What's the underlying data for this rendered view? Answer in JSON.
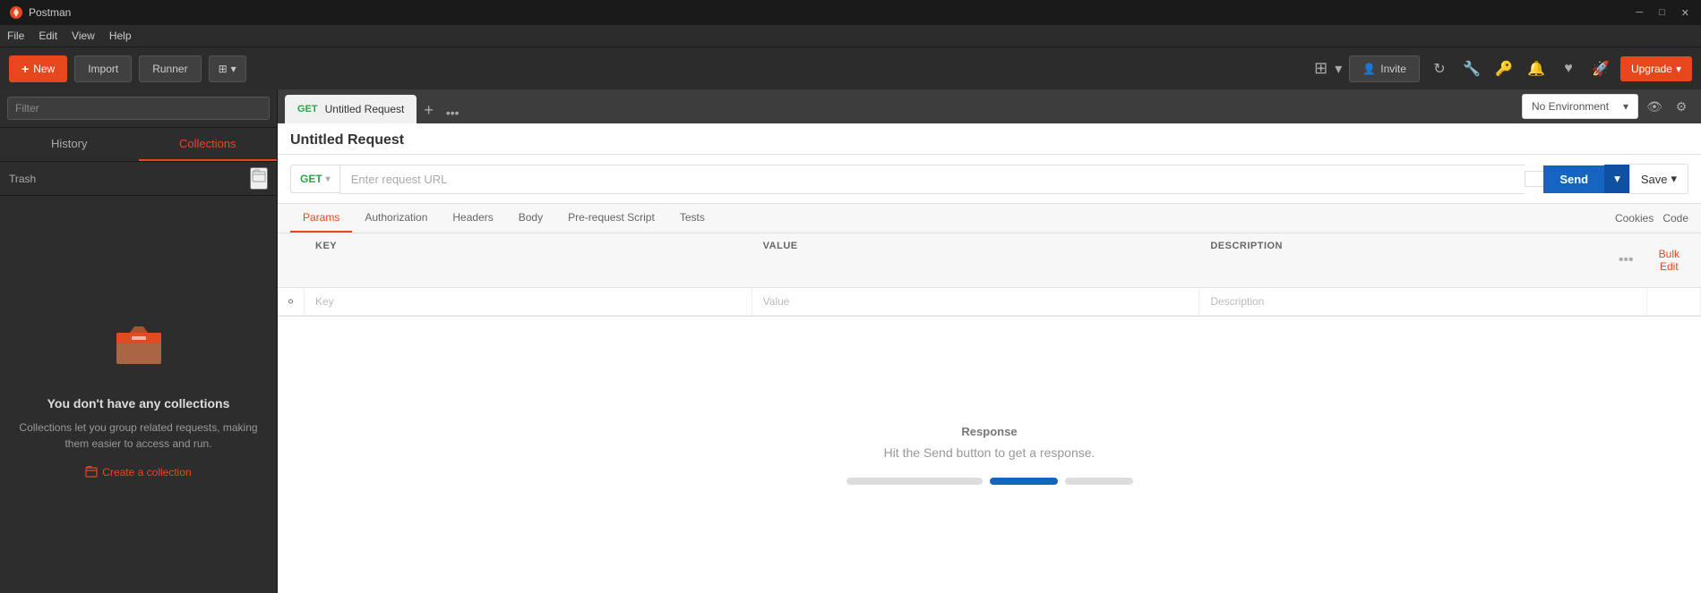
{
  "app": {
    "title": "Postman",
    "window_controls": {
      "minimize": "─",
      "maximize": "□",
      "close": "✕"
    }
  },
  "menu": {
    "items": [
      "File",
      "Edit",
      "View",
      "Help"
    ]
  },
  "toolbar": {
    "new_label": "New",
    "import_label": "Import",
    "runner_label": "Runner",
    "custom_icon": "⊞",
    "grid_icon": "⊞",
    "invite_label": "Invite",
    "sync_icon": "↻",
    "wrench_icon": "🔧",
    "bell_icon": "🔔",
    "heart_icon": "♥",
    "rocket_icon": "🚀",
    "upgrade_label": "Upgrade",
    "upgrade_dropdown": "▾"
  },
  "sidebar": {
    "search_placeholder": "Filter",
    "tabs": [
      {
        "id": "history",
        "label": "History"
      },
      {
        "id": "collections",
        "label": "Collections"
      }
    ],
    "active_tab": "collections",
    "trash_label": "Trash",
    "new_folder_icon": "⊞",
    "empty_state": {
      "heading": "You don't have any collections",
      "description": "Collections let you group related requests,\nmaking them easier to access and run.",
      "create_label": "Create a collection",
      "create_icon": "⊞"
    }
  },
  "tabs_bar": {
    "active_tab": {
      "method": "GET",
      "name": "Untitled Request"
    },
    "plus_label": "+",
    "more_label": "•••"
  },
  "env_bar": {
    "no_environment_label": "No Environment",
    "dropdown_arrow": "▾",
    "eye_icon": "👁",
    "gear_icon": "⚙"
  },
  "request": {
    "title": "Untitled Request",
    "method": "GET",
    "method_dropdown": "▾",
    "url_placeholder": "Enter request URL",
    "params_badge": "",
    "send_label": "Send",
    "send_dropdown": "▾",
    "save_label": "Save",
    "save_dropdown": "▾",
    "subtabs": [
      {
        "id": "params",
        "label": "Params"
      },
      {
        "id": "authorization",
        "label": "Authorization"
      },
      {
        "id": "headers",
        "label": "Headers"
      },
      {
        "id": "body",
        "label": "Body"
      },
      {
        "id": "pre-request-script",
        "label": "Pre-request Script"
      },
      {
        "id": "tests",
        "label": "Tests"
      }
    ],
    "active_subtab": "params",
    "cookies_label": "Cookies",
    "code_label": "Code",
    "params_table": {
      "columns": [
        "",
        "KEY",
        "VALUE",
        "DESCRIPTION",
        ""
      ],
      "key_placeholder": "Key",
      "value_placeholder": "Value",
      "description_placeholder": "Description",
      "more_icon": "•••",
      "bulk_edit_label": "Bulk Edit"
    }
  },
  "response": {
    "section_label": "Response",
    "placeholder_text": "Hit the Send button to get a response."
  }
}
